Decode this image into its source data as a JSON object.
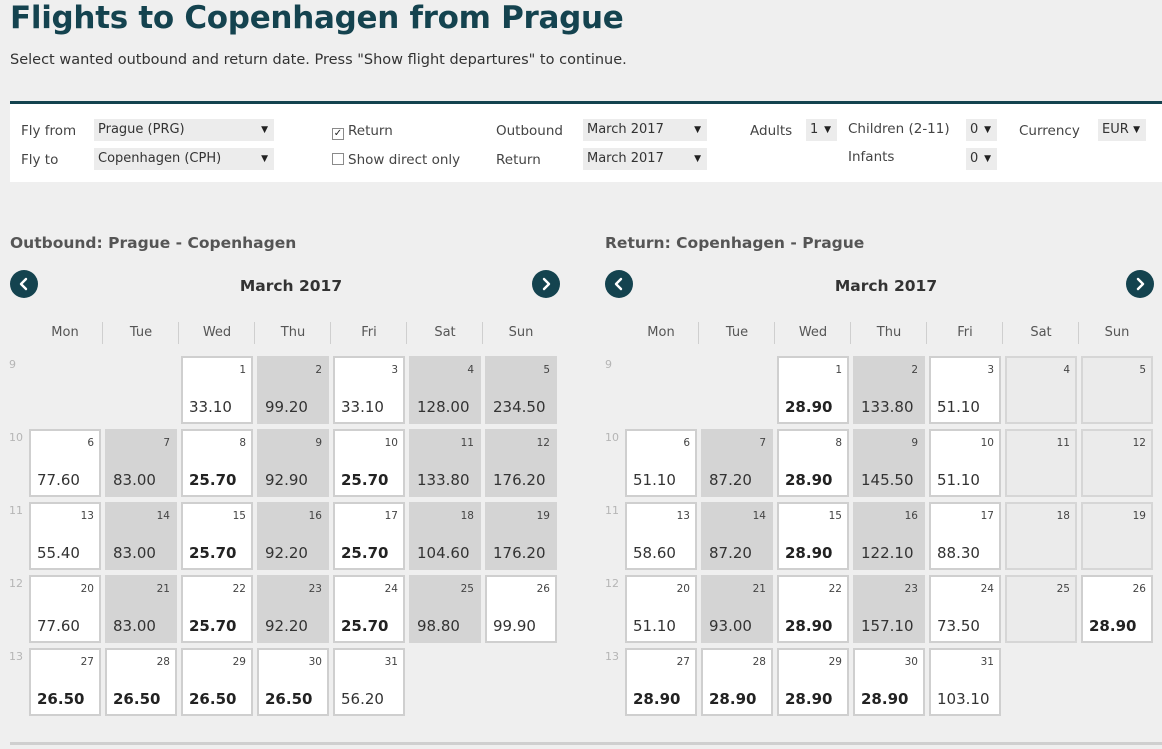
{
  "page": {
    "title": "Flights to Copenhagen from Prague",
    "subtitle": "Select wanted outbound and return date. Press \"Show flight departures\" to continue."
  },
  "search": {
    "fly_from_label": "Fly from",
    "fly_from_value": "Prague (PRG)",
    "fly_to_label": "Fly to",
    "fly_to_value": "Copenhagen (CPH)",
    "return_label": "Return",
    "return_checked": true,
    "direct_label": "Show direct only",
    "direct_checked": false,
    "outbound_label": "Outbound",
    "outbound_value": "March 2017",
    "return_date_label": "Return",
    "return_date_value": "March 2017",
    "adults_label": "Adults",
    "adults_value": "1",
    "children_label": "Children (2-11)",
    "children_value": "0",
    "infants_label": "Infants",
    "infants_value": "0",
    "currency_label": "Currency",
    "currency_value": "EUR"
  },
  "weekdays": [
    "Mon",
    "Tue",
    "Wed",
    "Thu",
    "Fri",
    "Sat",
    "Sun"
  ],
  "outbound": {
    "heading": "Outbound:  Prague - Copenhagen",
    "month": "March 2017",
    "weeks": [
      "9",
      "10",
      "11",
      "12",
      "13"
    ],
    "days": [
      {
        "d": "1",
        "p": "33.10",
        "s": "white"
      },
      {
        "d": "2",
        "p": "99.20",
        "s": "grey"
      },
      {
        "d": "3",
        "p": "33.10",
        "s": "white"
      },
      {
        "d": "4",
        "p": "128.00",
        "s": "grey"
      },
      {
        "d": "5",
        "p": "234.50",
        "s": "grey"
      },
      {
        "d": "6",
        "p": "77.60",
        "s": "white"
      },
      {
        "d": "7",
        "p": "83.00",
        "s": "grey"
      },
      {
        "d": "8",
        "p": "25.70",
        "s": "white",
        "b": true
      },
      {
        "d": "9",
        "p": "92.90",
        "s": "grey"
      },
      {
        "d": "10",
        "p": "25.70",
        "s": "white",
        "b": true
      },
      {
        "d": "11",
        "p": "133.80",
        "s": "grey"
      },
      {
        "d": "12",
        "p": "176.20",
        "s": "grey"
      },
      {
        "d": "13",
        "p": "55.40",
        "s": "white"
      },
      {
        "d": "14",
        "p": "83.00",
        "s": "grey"
      },
      {
        "d": "15",
        "p": "25.70",
        "s": "white",
        "b": true
      },
      {
        "d": "16",
        "p": "92.20",
        "s": "grey"
      },
      {
        "d": "17",
        "p": "25.70",
        "s": "white",
        "b": true
      },
      {
        "d": "18",
        "p": "104.60",
        "s": "grey"
      },
      {
        "d": "19",
        "p": "176.20",
        "s": "grey"
      },
      {
        "d": "20",
        "p": "77.60",
        "s": "white"
      },
      {
        "d": "21",
        "p": "83.00",
        "s": "grey"
      },
      {
        "d": "22",
        "p": "25.70",
        "s": "white",
        "b": true
      },
      {
        "d": "23",
        "p": "92.20",
        "s": "grey"
      },
      {
        "d": "24",
        "p": "25.70",
        "s": "white",
        "b": true
      },
      {
        "d": "25",
        "p": "98.80",
        "s": "grey"
      },
      {
        "d": "26",
        "p": "99.90",
        "s": "white"
      },
      {
        "d": "27",
        "p": "26.50",
        "s": "white",
        "b": true
      },
      {
        "d": "28",
        "p": "26.50",
        "s": "white",
        "b": true
      },
      {
        "d": "29",
        "p": "26.50",
        "s": "white",
        "b": true
      },
      {
        "d": "30",
        "p": "26.50",
        "s": "white",
        "b": true
      },
      {
        "d": "31",
        "p": "56.20",
        "s": "white"
      }
    ]
  },
  "return": {
    "heading": "Return:  Copenhagen - Prague",
    "month": "March 2017",
    "weeks": [
      "9",
      "10",
      "11",
      "12",
      "13"
    ],
    "days": [
      {
        "d": "1",
        "p": "28.90",
        "s": "white",
        "b": true
      },
      {
        "d": "2",
        "p": "133.80",
        "s": "grey"
      },
      {
        "d": "3",
        "p": "51.10",
        "s": "white"
      },
      {
        "d": "4",
        "p": "",
        "s": "empty"
      },
      {
        "d": "5",
        "p": "",
        "s": "empty"
      },
      {
        "d": "6",
        "p": "51.10",
        "s": "white"
      },
      {
        "d": "7",
        "p": "87.20",
        "s": "grey"
      },
      {
        "d": "8",
        "p": "28.90",
        "s": "white",
        "b": true
      },
      {
        "d": "9",
        "p": "145.50",
        "s": "grey"
      },
      {
        "d": "10",
        "p": "51.10",
        "s": "white"
      },
      {
        "d": "11",
        "p": "",
        "s": "empty"
      },
      {
        "d": "12",
        "p": "",
        "s": "empty"
      },
      {
        "d": "13",
        "p": "58.60",
        "s": "white"
      },
      {
        "d": "14",
        "p": "87.20",
        "s": "grey"
      },
      {
        "d": "15",
        "p": "28.90",
        "s": "white",
        "b": true
      },
      {
        "d": "16",
        "p": "122.10",
        "s": "grey"
      },
      {
        "d": "17",
        "p": "88.30",
        "s": "white"
      },
      {
        "d": "18",
        "p": "",
        "s": "empty"
      },
      {
        "d": "19",
        "p": "",
        "s": "empty"
      },
      {
        "d": "20",
        "p": "51.10",
        "s": "white"
      },
      {
        "d": "21",
        "p": "93.00",
        "s": "grey"
      },
      {
        "d": "22",
        "p": "28.90",
        "s": "white",
        "b": true
      },
      {
        "d": "23",
        "p": "157.10",
        "s": "grey"
      },
      {
        "d": "24",
        "p": "73.50",
        "s": "white"
      },
      {
        "d": "25",
        "p": "",
        "s": "empty"
      },
      {
        "d": "26",
        "p": "28.90",
        "s": "white",
        "b": true
      },
      {
        "d": "27",
        "p": "28.90",
        "s": "white",
        "b": true
      },
      {
        "d": "28",
        "p": "28.90",
        "s": "white",
        "b": true
      },
      {
        "d": "29",
        "p": "28.90",
        "s": "white",
        "b": true
      },
      {
        "d": "30",
        "p": "28.90",
        "s": "white",
        "b": true
      },
      {
        "d": "31",
        "p": "103.10",
        "s": "white"
      }
    ]
  }
}
